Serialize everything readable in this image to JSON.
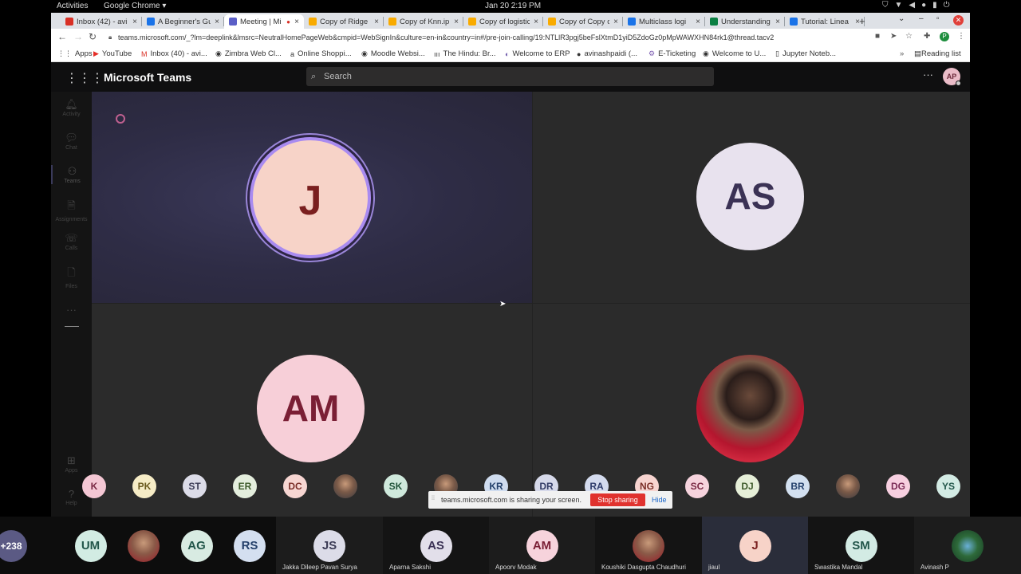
{
  "system": {
    "activities": "Activities",
    "app_menu": "Google Chrome ▾",
    "clock": "Jan 20  2:19 PM"
  },
  "browser": {
    "tabs": [
      {
        "title": "Inbox (42) - avi",
        "icon": "gmail-icon",
        "color": "#d93025"
      },
      {
        "title": "A Beginner's Gui",
        "icon": "site-icon",
        "color": "#1a73e8"
      },
      {
        "title": "Meeting | Mi",
        "icon": "teams-icon",
        "color": "#5b5fc7",
        "active": true
      },
      {
        "title": "Copy of Ridge",
        "icon": "colab-icon",
        "color": "#f9ab00"
      },
      {
        "title": "Copy of Knn.ip",
        "icon": "colab-icon",
        "color": "#f9ab00"
      },
      {
        "title": "Copy of logistic",
        "icon": "colab-icon",
        "color": "#f9ab00"
      },
      {
        "title": "Copy of Copy o",
        "icon": "colab-icon",
        "color": "#f9ab00"
      },
      {
        "title": "Multiclass logi",
        "icon": "site-icon",
        "color": "#1a73e8"
      },
      {
        "title": "Understanding",
        "icon": "site-icon",
        "color": "#0b8043"
      },
      {
        "title": "Tutorial: Linea",
        "icon": "site-icon",
        "color": "#1a73e8"
      }
    ],
    "url": "teams.microsoft.com/_?lm=deeplink&lmsrc=NeutralHomePageWeb&cmpid=WebSignIn&culture=en-in&country=in#/pre-join-calling/19:NTLlR3pgj5beFslXtmD1yiD5ZdoGz0pMpWAWXHN84rk1@thread.tacv2",
    "profile_initial": "P",
    "bookmarks": [
      {
        "label": "Apps",
        "icon": "apps-grid-icon"
      },
      {
        "label": "YouTube",
        "icon": "youtube-icon"
      },
      {
        "label": "Inbox (40) - avi...",
        "icon": "gmail-icon"
      },
      {
        "label": "Zimbra Web Cl...",
        "icon": "globe-icon"
      },
      {
        "label": "Online Shoppi...",
        "icon": "amazon-icon"
      },
      {
        "label": "Moodle Websi...",
        "icon": "globe-icon"
      },
      {
        "label": "The Hindu: Br...",
        "icon": "hindu-icon"
      },
      {
        "label": "Welcome to ERP",
        "icon": "erp-icon"
      },
      {
        "label": "avinashpaidi (...",
        "icon": "github-icon"
      },
      {
        "label": "E-Ticketing",
        "icon": "ticket-icon"
      },
      {
        "label": "Welcome to U...",
        "icon": "globe-icon"
      },
      {
        "label": "Jupyter Noteb...",
        "icon": "doc-icon"
      }
    ],
    "reading_list": "Reading list"
  },
  "teams": {
    "app_title": "Microsoft Teams",
    "search_placeholder": "Search",
    "user_initials": "AP",
    "rail": [
      {
        "label": "Activity",
        "icon": "bell-icon"
      },
      {
        "label": "Chat",
        "icon": "chat-icon"
      },
      {
        "label": "Teams",
        "icon": "teams-icon",
        "active": true
      },
      {
        "label": "Assignments",
        "icon": "assignments-icon"
      },
      {
        "label": "Calls",
        "icon": "phone-icon"
      },
      {
        "label": "Files",
        "icon": "file-icon"
      }
    ],
    "rail_bottom": [
      {
        "label": "Apps",
        "icon": "apps-icon"
      },
      {
        "label": "Help",
        "icon": "help-icon"
      }
    ],
    "main_tiles": [
      {
        "initials": "J",
        "bg": "#f7d3c8",
        "fg": "#7a1f1f",
        "speaking": true
      },
      {
        "initials": "AS",
        "bg": "#e8e2ee",
        "fg": "#3b3255"
      },
      {
        "initials": "AM",
        "bg": "#f7cfd8",
        "fg": "#7a1f35"
      },
      {
        "initials": "",
        "photo": true
      }
    ],
    "strip": [
      {
        "initials": "K",
        "bg": "#f4c7d4",
        "fg": "#7a2a45",
        "partial": true
      },
      {
        "initials": "PK",
        "bg": "#f6ecc6",
        "fg": "#6b5a1e"
      },
      {
        "initials": "ST",
        "bg": "#dcdce8",
        "fg": "#3b3b55"
      },
      {
        "initials": "ER",
        "bg": "#e4eedd",
        "fg": "#3d5a2a"
      },
      {
        "initials": "DC",
        "bg": "#f7d6d2",
        "fg": "#7a2f28"
      },
      {
        "initials": "",
        "photo": true
      },
      {
        "initials": "SK",
        "bg": "#cfe9dc",
        "fg": "#22563c"
      },
      {
        "initials": "",
        "photo": true
      },
      {
        "initials": "KR",
        "bg": "#cfdcef",
        "fg": "#24406b"
      },
      {
        "initials": "DR",
        "bg": "#d6d9ea",
        "fg": "#333c66"
      },
      {
        "initials": "RA",
        "bg": "#d4dbee",
        "fg": "#2e3c6b"
      },
      {
        "initials": "NG",
        "bg": "#f7d4d0",
        "fg": "#7a2f28"
      },
      {
        "initials": "SC",
        "bg": "#f6d3dd",
        "fg": "#7a2a45"
      },
      {
        "initials": "DJ",
        "bg": "#e6efd8",
        "fg": "#3d5a2a"
      },
      {
        "initials": "BR",
        "bg": "#d3e0f0",
        "fg": "#24406b"
      },
      {
        "initials": "",
        "photo": true
      },
      {
        "initials": "DG",
        "bg": "#f7cfe0",
        "fg": "#7a2a55"
      },
      {
        "initials": "YS",
        "bg": "#d3ebe4",
        "fg": "#22564a"
      }
    ],
    "share_bar": {
      "message": "teams.microsoft.com is sharing your screen.",
      "stop": "Stop sharing",
      "hide": "Hide"
    }
  },
  "dock": [
    {
      "initials": "+238",
      "bg": "#5b5a84",
      "fg": "#ffffff",
      "name": ""
    },
    {
      "initials": "UM",
      "bg": "#d2ece3",
      "fg": "#22564a",
      "name": ""
    },
    {
      "initials": "",
      "photo": true,
      "name": ""
    },
    {
      "initials": "AG",
      "bg": "#d8ebe2",
      "fg": "#22564a",
      "name": ""
    },
    {
      "initials": "RS",
      "bg": "#d4dff0",
      "fg": "#24406b",
      "name": ""
    },
    {
      "initials": "JS",
      "bg": "#dcdce8",
      "fg": "#3b3b55",
      "name": "Jakka Dileep Pavan Surya"
    },
    {
      "initials": "AS",
      "bg": "#e2dfea",
      "fg": "#3b3255",
      "name": "Aparna Sakshi"
    },
    {
      "initials": "AM",
      "bg": "#f7d3dc",
      "fg": "#7a1f35",
      "name": "Apoorv Modak"
    },
    {
      "initials": "",
      "photo": true,
      "name": "Koushiki Dasgupta Chaudhuri"
    },
    {
      "initials": "J",
      "bg": "#f7d3c8",
      "fg": "#7a1f1f",
      "name": "jiaul"
    },
    {
      "initials": "SM",
      "bg": "#d3ebe4",
      "fg": "#22564a",
      "name": "Swastika Mandal"
    },
    {
      "initials": "",
      "photo": true,
      "name": "Avinash P"
    }
  ]
}
